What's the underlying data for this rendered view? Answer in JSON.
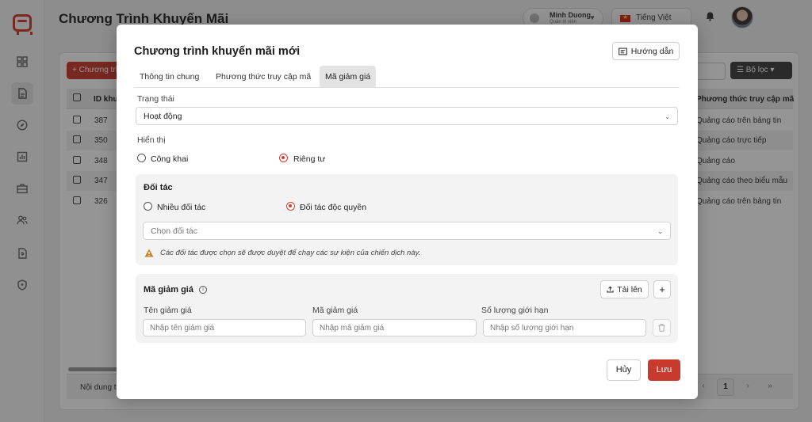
{
  "app": {
    "title": "Chương Trình Khuyến Mãi",
    "user": {
      "name": "Minh Duong",
      "role": "Quản trị viên"
    },
    "language": "Tiếng Việt",
    "colors": {
      "primary": "#c73a2d",
      "dark_button": "#3d3d3d"
    }
  },
  "sidebar": {
    "icons": [
      "logo-icon",
      "dashboard-icon",
      "document-icon",
      "compass-icon",
      "chart-icon",
      "briefcase-icon",
      "users-icon",
      "invoice-icon",
      "shield-icon"
    ]
  },
  "page": {
    "add_button": "+ Chương trình",
    "filter_button": "Bộ lọc",
    "table": {
      "headers": {
        "id": "ID khuyến mãi",
        "access_method": "Phương thức truy cập mã"
      },
      "rows": [
        {
          "id": "387",
          "access_method": "Quảng cáo trên bảng tin"
        },
        {
          "id": "350",
          "access_method": "Quảng cáo trực tiếp"
        },
        {
          "id": "348",
          "access_method": "Quảng cáo"
        },
        {
          "id": "347",
          "access_method": "Quảng cáo theo biểu mẫu"
        },
        {
          "id": "326",
          "access_method": "Quảng cáo trên bảng tin"
        }
      ]
    },
    "footer_text": "Nội dung trang",
    "pagination": {
      "prev_all": "«",
      "prev": "‹",
      "current": "1",
      "next": "›",
      "next_all": "»"
    }
  },
  "modal": {
    "title": "Chương trình khuyến mãi mới",
    "guide_button": "Hướng dẫn",
    "tabs": [
      {
        "label": "Thông tin chung"
      },
      {
        "label": "Phương thức truy cập mã"
      },
      {
        "label": "Mã giảm giá"
      }
    ],
    "status": {
      "label": "Trạng thái",
      "value": "Hoạt động"
    },
    "visibility": {
      "label": "Hiển thị",
      "options": [
        {
          "label": "Công khai",
          "checked": false
        },
        {
          "label": "Riêng tư",
          "checked": true
        }
      ]
    },
    "partner": {
      "title": "Đối tác",
      "options": [
        {
          "label": "Nhiều đối tác",
          "checked": false
        },
        {
          "label": "Đối tác độc quyền",
          "checked": true
        }
      ],
      "select_placeholder": "Chọn đối tác",
      "warning": "Các đối tác được chọn sẽ được duyệt để chạy các sự kiện của chiến dịch này."
    },
    "discount": {
      "title": "Mã giảm giá",
      "upload_button": "Tải lên",
      "add_button": "+",
      "columns": {
        "name": {
          "label": "Tên giảm giá",
          "placeholder": "Nhập tên giảm giá"
        },
        "code": {
          "label": "Mã giảm giá",
          "placeholder": "Nhập mã giảm giá"
        },
        "limit": {
          "label": "Số lượng giới hạn",
          "placeholder": "Nhập số lượng giới hạn"
        }
      }
    },
    "cancel_button": "Hủy",
    "save_button": "Lưu"
  }
}
